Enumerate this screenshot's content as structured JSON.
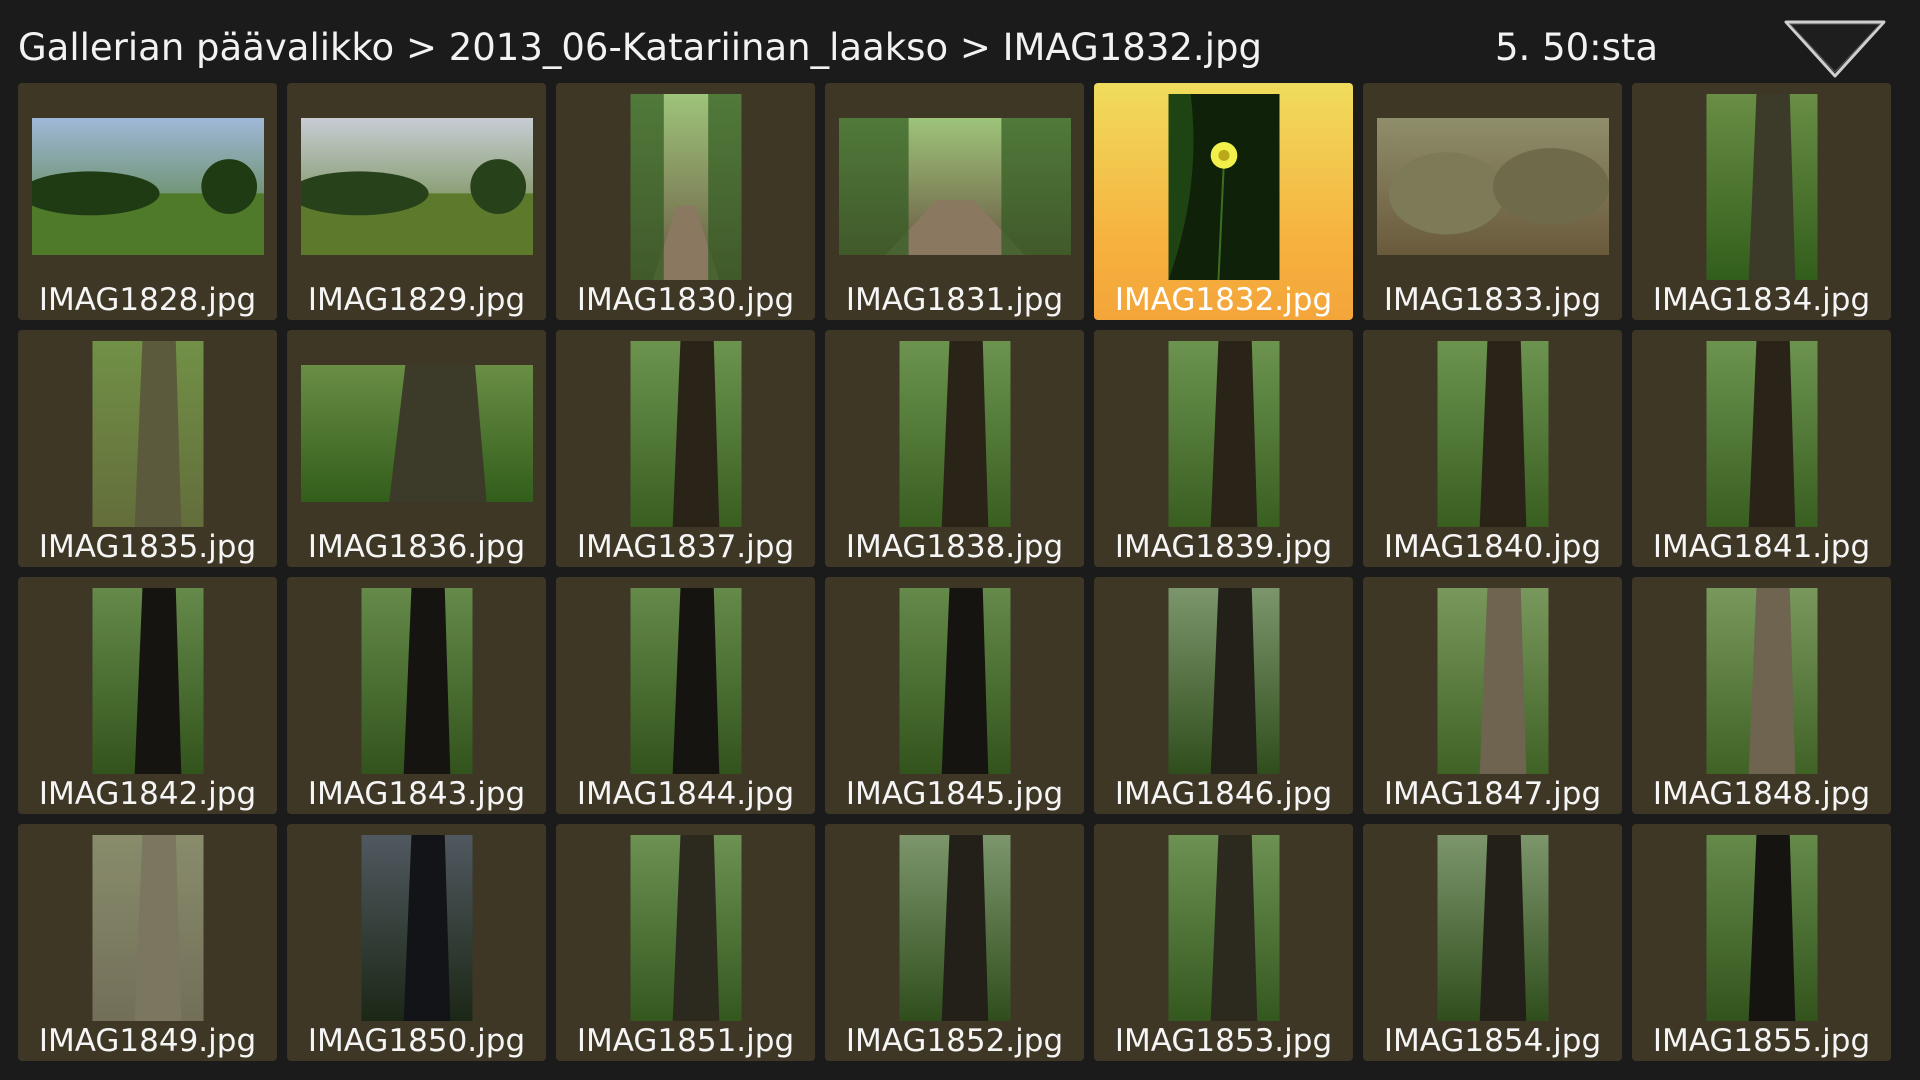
{
  "header": {
    "breadcrumb": "Gallerian päävalikko > 2013_06-Katariinan_laakso > IMAG1832.jpg",
    "counter": "5. 50:sta",
    "menu_icon": "dropdown-triangle-icon"
  },
  "colors": {
    "background": "#1b1b1b",
    "tile": "#3f3726",
    "selected_top": "#f0dc5c",
    "selected_bottom": "#f4a53a"
  },
  "gallery": {
    "items": [
      {
        "label": "IMAG1828.jpg",
        "orientation": "landscape",
        "scene": "meadow"
      },
      {
        "label": "IMAG1829.jpg",
        "orientation": "landscape",
        "scene": "meadow-clouds"
      },
      {
        "label": "IMAG1830.jpg",
        "orientation": "portrait",
        "scene": "forest-path"
      },
      {
        "label": "IMAG1831.jpg",
        "orientation": "landscape",
        "scene": "forest-path"
      },
      {
        "label": "IMAG1832.jpg",
        "orientation": "portrait",
        "scene": "flower",
        "selected": true
      },
      {
        "label": "IMAG1833.jpg",
        "orientation": "landscape",
        "scene": "rocks"
      },
      {
        "label": "IMAG1834.jpg",
        "orientation": "portrait",
        "scene": "canopy"
      },
      {
        "label": "IMAG1835.jpg",
        "orientation": "portrait",
        "scene": "forest-light"
      },
      {
        "label": "IMAG1836.jpg",
        "orientation": "landscape",
        "scene": "canopy"
      },
      {
        "label": "IMAG1837.jpg",
        "orientation": "portrait",
        "scene": "trunk"
      },
      {
        "label": "IMAG1838.jpg",
        "orientation": "portrait",
        "scene": "trunk"
      },
      {
        "label": "IMAG1839.jpg",
        "orientation": "portrait",
        "scene": "trunk"
      },
      {
        "label": "IMAG1840.jpg",
        "orientation": "portrait",
        "scene": "trunk"
      },
      {
        "label": "IMAG1841.jpg",
        "orientation": "portrait",
        "scene": "trunk"
      },
      {
        "label": "IMAG1842.jpg",
        "orientation": "portrait",
        "scene": "trunk-dark"
      },
      {
        "label": "IMAG1843.jpg",
        "orientation": "portrait",
        "scene": "trunk-dark"
      },
      {
        "label": "IMAG1844.jpg",
        "orientation": "portrait",
        "scene": "trunk-dark"
      },
      {
        "label": "IMAG1845.jpg",
        "orientation": "portrait",
        "scene": "trunk-dark"
      },
      {
        "label": "IMAG1846.jpg",
        "orientation": "portrait",
        "scene": "trunk-sun"
      },
      {
        "label": "IMAG1847.jpg",
        "orientation": "portrait",
        "scene": "trunk-bark"
      },
      {
        "label": "IMAG1848.jpg",
        "orientation": "portrait",
        "scene": "trunk-bark"
      },
      {
        "label": "IMAG1849.jpg",
        "orientation": "portrait",
        "scene": "bark"
      },
      {
        "label": "IMAG1850.jpg",
        "orientation": "portrait",
        "scene": "sky-silhouette"
      },
      {
        "label": "IMAG1851.jpg",
        "orientation": "portrait",
        "scene": "forest"
      },
      {
        "label": "IMAG1852.jpg",
        "orientation": "portrait",
        "scene": "trunk-sun"
      },
      {
        "label": "IMAG1853.jpg",
        "orientation": "portrait",
        "scene": "forest"
      },
      {
        "label": "IMAG1854.jpg",
        "orientation": "portrait",
        "scene": "trunk-sun"
      },
      {
        "label": "IMAG1855.jpg",
        "orientation": "portrait",
        "scene": "trunk-dark"
      }
    ]
  }
}
